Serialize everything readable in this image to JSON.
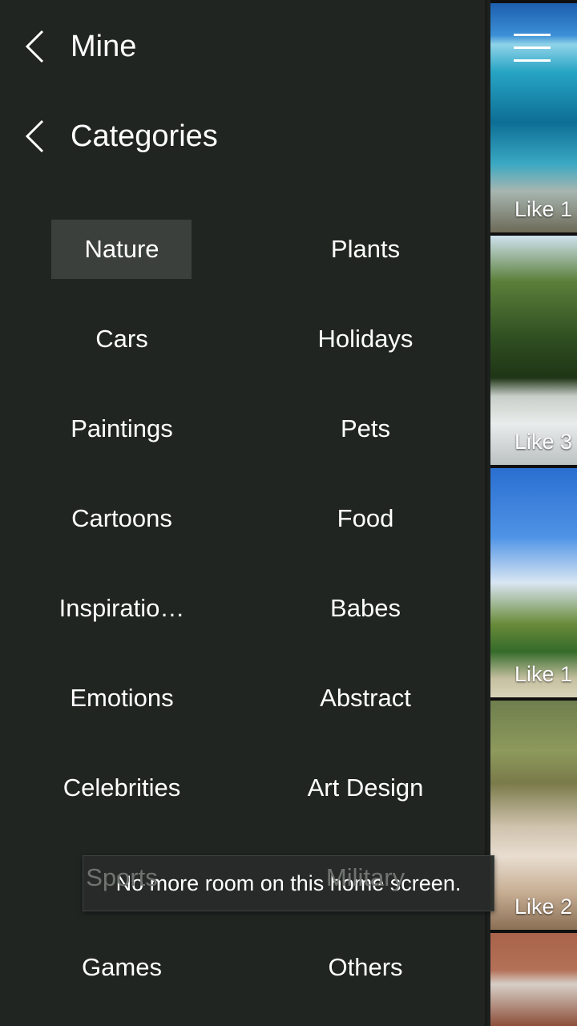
{
  "drawer": {
    "mine_label": "Mine",
    "categories_label": "Categories",
    "selected_category": "Nature",
    "categories": [
      "Nature",
      "Plants",
      "Cars",
      "Holidays",
      "Paintings",
      "Pets",
      "Cartoons",
      "Food",
      "Inspiratio…",
      "Babes",
      "Emotions",
      "Abstract",
      "Celebrities",
      "Art Design",
      "Sports",
      "Military",
      "Games",
      "Others"
    ]
  },
  "strip": {
    "menu_icon": "hamburger-menu-icon",
    "thumbnails": [
      {
        "like_text": "Like 1"
      },
      {
        "like_text": "Like 3"
      },
      {
        "like_text": "Like 1"
      },
      {
        "like_text": "Like 2"
      },
      {
        "like_text": ""
      }
    ]
  },
  "toast": {
    "message": "No more room on this home screen."
  },
  "colors": {
    "drawer_background": "#202522",
    "selected_background": "#3b403d",
    "text": "#ffffff"
  }
}
